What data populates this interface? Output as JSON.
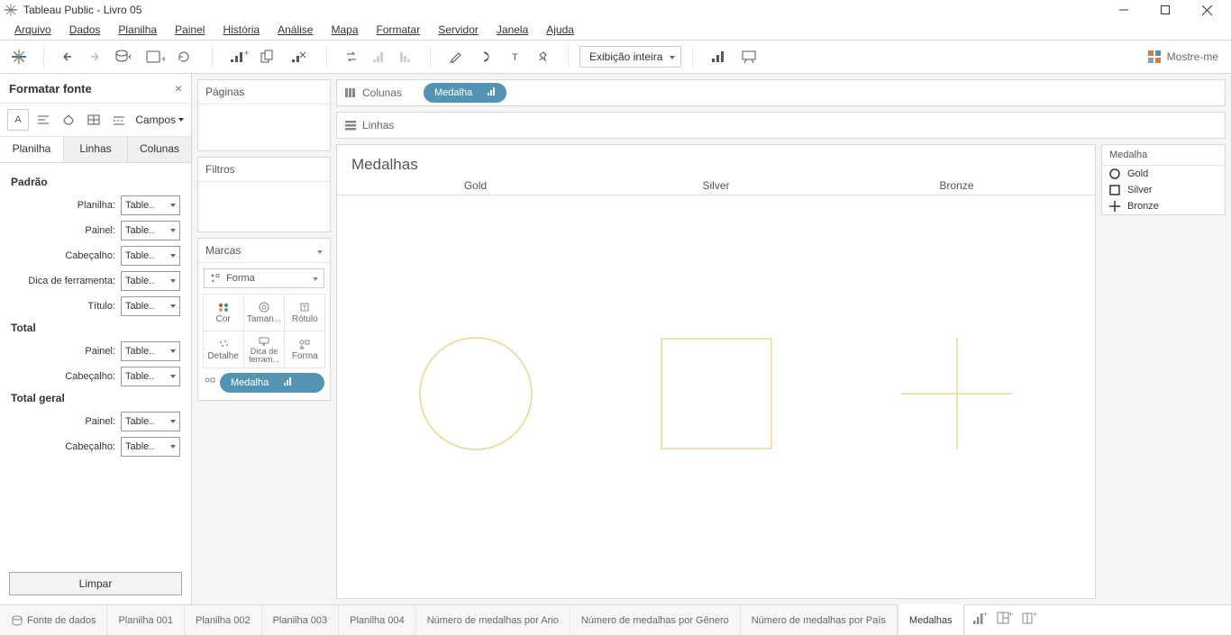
{
  "window": {
    "title": "Tableau Public - Livro 05"
  },
  "menu": [
    "Arquivo",
    "Dados",
    "Planilha",
    "Painel",
    "História",
    "Análise",
    "Mapa",
    "Formatar",
    "Servidor",
    "Janela",
    "Ajuda"
  ],
  "toolbar": {
    "fit_label": "Exibição inteira",
    "show_me": "Mostre-me"
  },
  "format_pane": {
    "title": "Formatar fonte",
    "fields_label": "Campos",
    "tabs": [
      "Planilha",
      "Linhas",
      "Colunas"
    ],
    "active_tab": 0,
    "sections": [
      {
        "title": "Padrão",
        "rows": [
          {
            "label": "Planilha:",
            "value": "Table.."
          },
          {
            "label": "Painel:",
            "value": "Table.."
          },
          {
            "label": "Cabeçalho:",
            "value": "Table.."
          },
          {
            "label": "Dica de ferramenta:",
            "value": "Table.."
          },
          {
            "label": "Título:",
            "value": "Table.."
          }
        ]
      },
      {
        "title": "Total",
        "rows": [
          {
            "label": "Painel:",
            "value": "Table.."
          },
          {
            "label": "Cabeçalho:",
            "value": "Table.."
          }
        ]
      },
      {
        "title": "Total geral",
        "rows": [
          {
            "label": "Painel:",
            "value": "Table.."
          },
          {
            "label": "Cabeçalho:",
            "value": "Table.."
          }
        ]
      }
    ],
    "clear_label": "Limpar"
  },
  "pages": {
    "title": "Páginas"
  },
  "filters": {
    "title": "Filtros"
  },
  "marks": {
    "title": "Marcas",
    "shape_label": "Forma",
    "cells": [
      "Cor",
      "Taman...",
      "Rótulo",
      "Detalhe",
      "Dica de ferram...",
      "Forma"
    ],
    "pill": "Medalha"
  },
  "shelves": {
    "columns_label": "Colunas",
    "columns_pill": "Medalha",
    "rows_label": "Linhas"
  },
  "viz": {
    "title": "Medalhas",
    "headers": [
      "Gold",
      "Silver",
      "Bronze"
    ]
  },
  "legend": {
    "title": "Medalha",
    "items": [
      {
        "shape": "circle",
        "label": "Gold"
      },
      {
        "shape": "square",
        "label": "Silver"
      },
      {
        "shape": "plus",
        "label": "Bronze"
      }
    ]
  },
  "tabs": {
    "data_source": "Fonte de dados",
    "sheets": [
      "Planilha 001",
      "Planilha 002",
      "Planilha 003",
      "Planilha 004",
      "Número de medalhas por Ano",
      "Número de medalhas por Gênero",
      "Número de medalhas por País",
      "Medalhas"
    ],
    "active": 7
  },
  "chart_data": {
    "type": "table",
    "title": "Medalhas",
    "categories": [
      "Gold",
      "Silver",
      "Bronze"
    ],
    "series": [
      {
        "name": "Medalha",
        "shapes": [
          "circle",
          "square",
          "plus"
        ]
      }
    ]
  }
}
